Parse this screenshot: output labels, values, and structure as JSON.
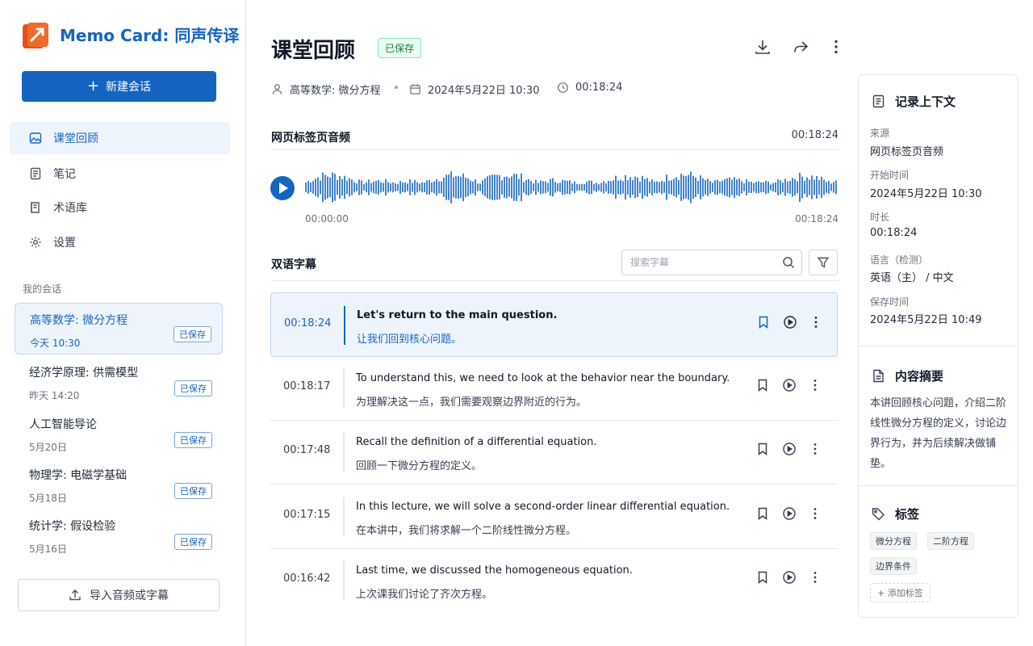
{
  "app": {
    "title": "Memo Card: 同声传译"
  },
  "sidebar": {
    "new_button": "新建会话",
    "nav": [
      {
        "label": "课堂回顾",
        "icon": "image-icon",
        "active": true
      },
      {
        "label": "笔记",
        "icon": "note-icon"
      },
      {
        "label": "术语库",
        "icon": "book-icon"
      },
      {
        "label": "设置",
        "icon": "gear-icon"
      }
    ],
    "section_label": "我的会话",
    "sessions": [
      {
        "title": "高等数学: 微分方程",
        "date": "今天 10:30",
        "badge": "已保存",
        "active": true
      },
      {
        "title": "经济学原理: 供需模型",
        "date": "昨天 14:20",
        "badge": "已保存"
      },
      {
        "title": "人工智能导论",
        "date": "5月20日",
        "badge": "已保存"
      },
      {
        "title": "物理学: 电磁学基础",
        "date": "5月18日",
        "badge": "已保存"
      },
      {
        "title": "统计学: 假设检验",
        "date": "5月16日",
        "badge": "已保存"
      }
    ],
    "import_button": "导入音频或字幕"
  },
  "header": {
    "title": "课堂回顾",
    "status": "已保存",
    "course": "高等数学: 微分方程",
    "date": "2024年5月22日 10:30",
    "duration": "00:18:24"
  },
  "audio": {
    "label": "网页标签页音频",
    "duration": "00:18:24",
    "start": "00:00:00",
    "end": "00:18:24"
  },
  "subtitles": {
    "label": "双语字幕",
    "search_placeholder": "搜索字幕",
    "rows": [
      {
        "time": "00:18:24",
        "en": "Let's return to the main question.",
        "zh": "让我们回到核心问题。",
        "active": true
      },
      {
        "time": "00:18:17",
        "en": "To understand this, we need to look at the behavior near the boundary.",
        "zh": "为理解决这一点，我们需要观察边界附近的行为。"
      },
      {
        "time": "00:17:48",
        "en": "Recall the definition of a differential equation.",
        "zh": "回顾一下微分方程的定义。"
      },
      {
        "time": "00:17:15",
        "en": "In this lecture, we will solve a second-order linear differential equation.",
        "zh": "在本讲中，我们将求解一个二阶线性微分方程。"
      },
      {
        "time": "00:16:42",
        "en": "Last time, we discussed the homogeneous equation.",
        "zh": "上次课我们讨论了齐次方程。"
      }
    ]
  },
  "context": {
    "title": "记录上下文",
    "fields": [
      {
        "key": "来源",
        "value": "网页标签页音频"
      },
      {
        "key": "开始时间",
        "value": "2024年5月22日 10:30"
      },
      {
        "key": "时长",
        "value": "00:18:24"
      },
      {
        "key": "语言（检测）",
        "value": "英语（主） / 中文"
      },
      {
        "key": "保存时间",
        "value": "2024年5月22日 10:49"
      }
    ]
  },
  "summary": {
    "title": "内容摘要",
    "text": "本讲回顾核心问题，介绍二阶线性微分方程的定义，讨论边界行为，并为后续解决做铺垫。"
  },
  "tags": {
    "title": "标签",
    "items": [
      "微分方程",
      "二阶方程",
      "边界条件"
    ],
    "add_label": "添加标签"
  },
  "colors": {
    "accent": "#1565c0",
    "saved_green": "#15803d",
    "active_bg": "#eef4fb"
  }
}
